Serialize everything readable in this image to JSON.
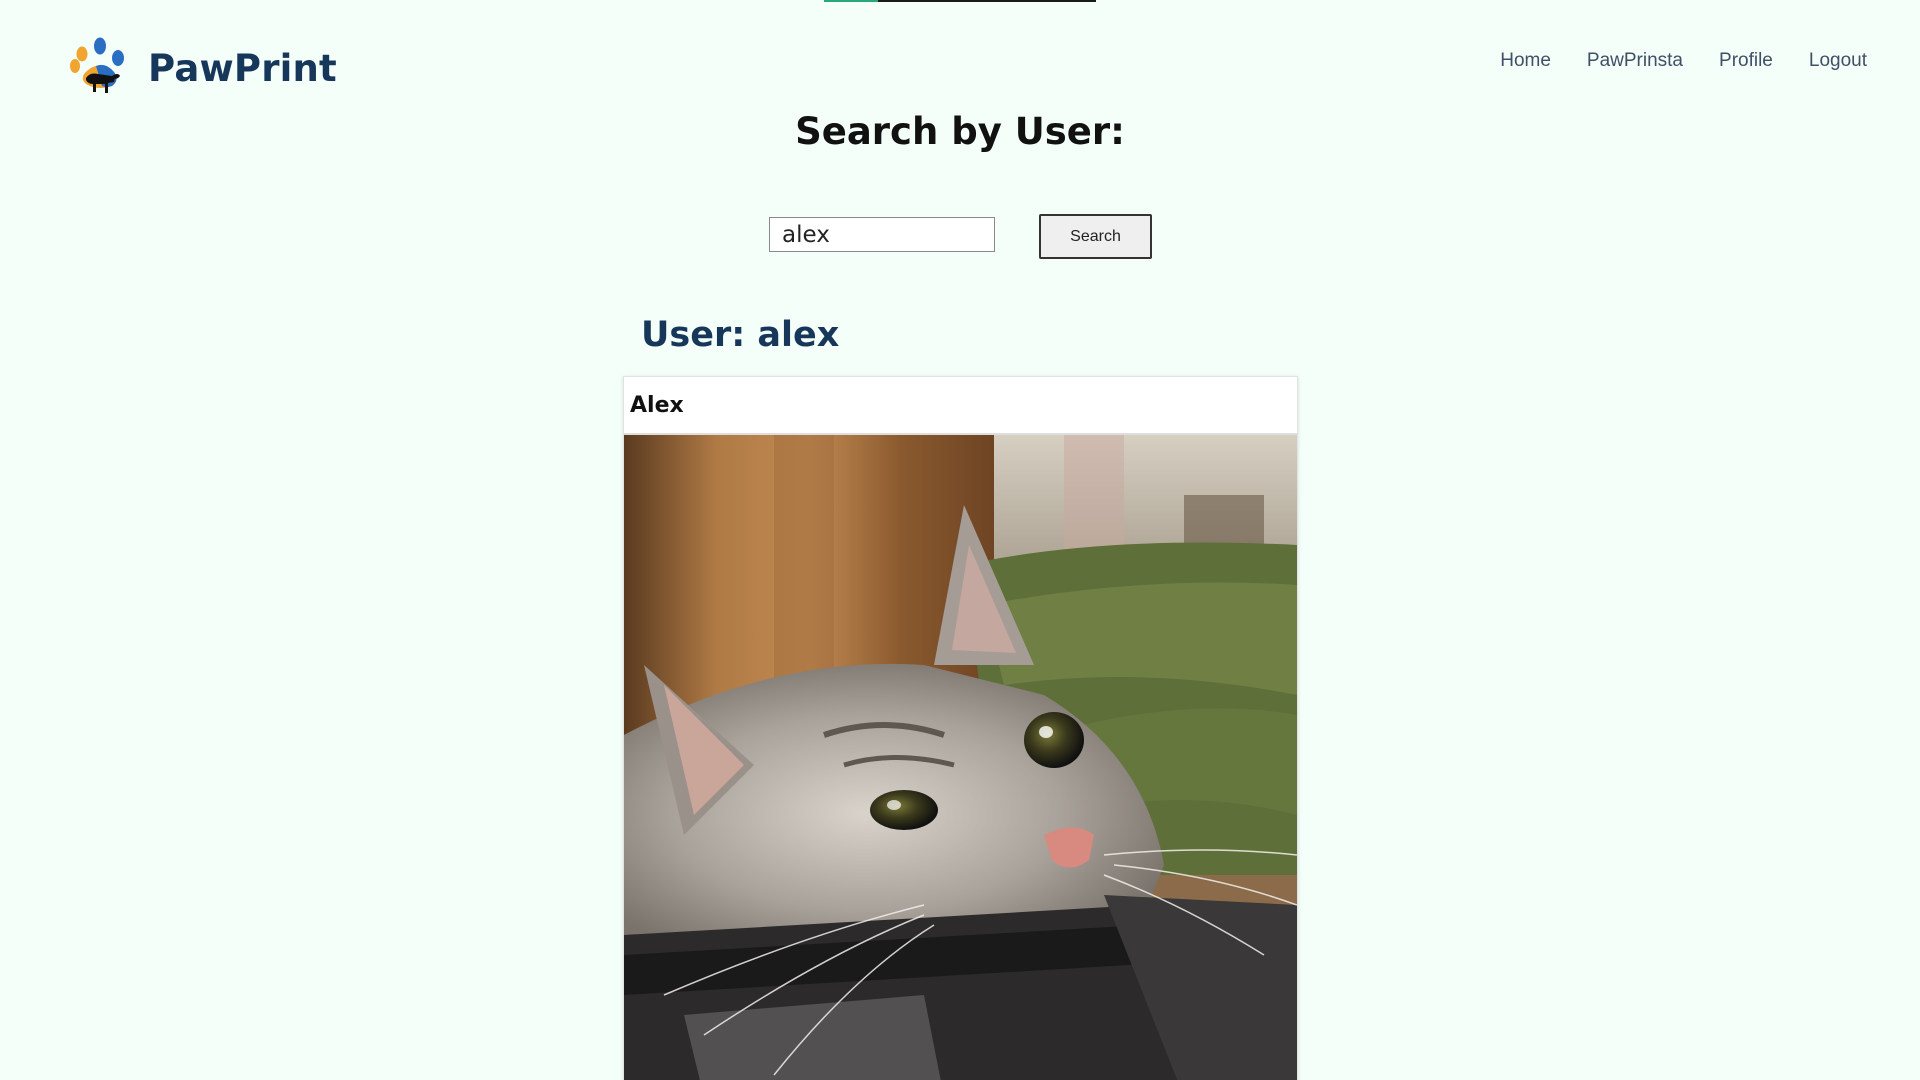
{
  "page": {
    "progress_fraction": 0.2
  },
  "header": {
    "logo_text": "PawPrint",
    "logo_icon": "paw-print-logo-icon",
    "nav": [
      {
        "label": "Home"
      },
      {
        "label": "PawPrinsta"
      },
      {
        "label": "Profile"
      },
      {
        "label": "Logout"
      }
    ]
  },
  "search": {
    "title": "Search by User:",
    "input_value": "alex",
    "button_label": "Search"
  },
  "result": {
    "heading": "User: alex",
    "card": {
      "name": "Alex",
      "image": "cat-photo"
    }
  },
  "colors": {
    "background": "#f5fffa",
    "brand": "#16365a",
    "progress": "#28a879"
  }
}
